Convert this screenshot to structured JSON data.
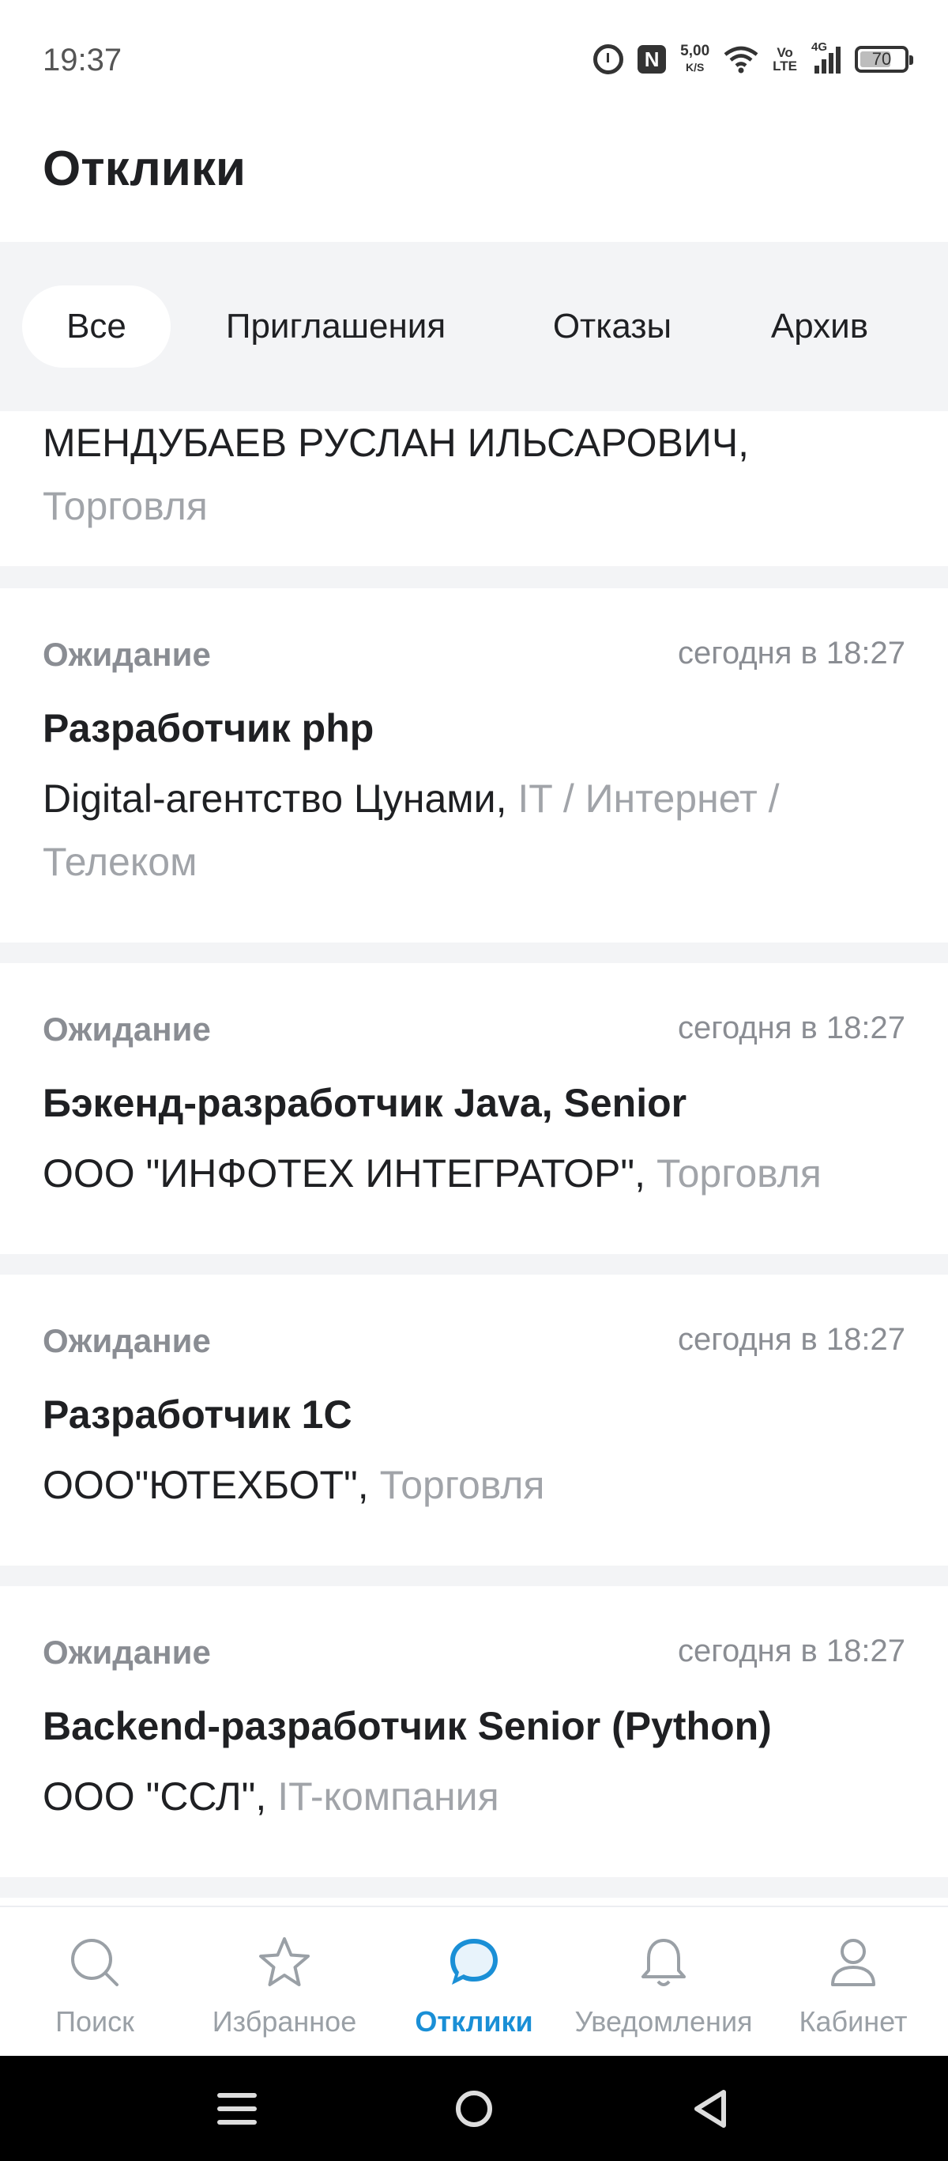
{
  "status_bar": {
    "time": "19:37",
    "speed_value": "5,00",
    "speed_unit": "K/S",
    "volte_top": "Vo",
    "volte_bottom": "LTE",
    "network": "4G",
    "battery": "70",
    "battery_level": 0.7,
    "icons": [
      "alarm-icon",
      "nfc-icon",
      "wifi-icon",
      "signal-icon",
      "battery-icon"
    ]
  },
  "header": {
    "title": "Отклики"
  },
  "tabs": [
    {
      "label": "Все",
      "active": true
    },
    {
      "label": "Приглашения",
      "active": false
    },
    {
      "label": "Отказы",
      "active": false
    },
    {
      "label": "Архив",
      "active": false
    }
  ],
  "responses": {
    "partial": {
      "company": "МЕНДУБАЕВ РУСЛАН ИЛЬСАРОВИЧ,",
      "industry": "Торговля"
    },
    "items": [
      {
        "status": "Ожидание",
        "date": "сегодня в 18:27",
        "title": "Разработчик php",
        "company": "Digital-агентство Цунами,",
        "industry": "IT / Интернет / Телеком"
      },
      {
        "status": "Ожидание",
        "date": "сегодня в 18:27",
        "title": "Бэкенд-разработчик Java, Senior",
        "company": "ООО \"ИНФОТЕХ ИНТЕГРАТОР\",",
        "industry": "Торговля"
      },
      {
        "status": "Ожидание",
        "date": "сегодня в 18:27",
        "title": "Разработчик 1С",
        "company": "ООО\"ЮТЕХБОТ\",",
        "industry": "Торговля"
      },
      {
        "status": "Ожидание",
        "date": "сегодня в 18:27",
        "title": "Backend-разработчик Senior (Python)",
        "company": "ООО \"ССЛ\",",
        "industry": "IT-компания"
      }
    ]
  },
  "bottom_nav": [
    {
      "label": "Поиск",
      "icon": "search-icon",
      "active": false
    },
    {
      "label": "Избранное",
      "icon": "star-icon",
      "active": false
    },
    {
      "label": "Отклики",
      "icon": "chat-bubble-icon",
      "active": true
    },
    {
      "label": "Уведомления",
      "icon": "bell-icon",
      "active": false
    },
    {
      "label": "Кабинет",
      "icon": "profile-icon",
      "active": false
    }
  ],
  "colors": {
    "accent": "#1a8fd6",
    "muted_text": "#8a8d93",
    "industry_text": "#a1a4a9",
    "background_gray": "#f3f4f6",
    "inactive_icon": "#9aa0a6"
  },
  "system_nav": [
    "menu-icon",
    "home-icon",
    "back-icon"
  ]
}
